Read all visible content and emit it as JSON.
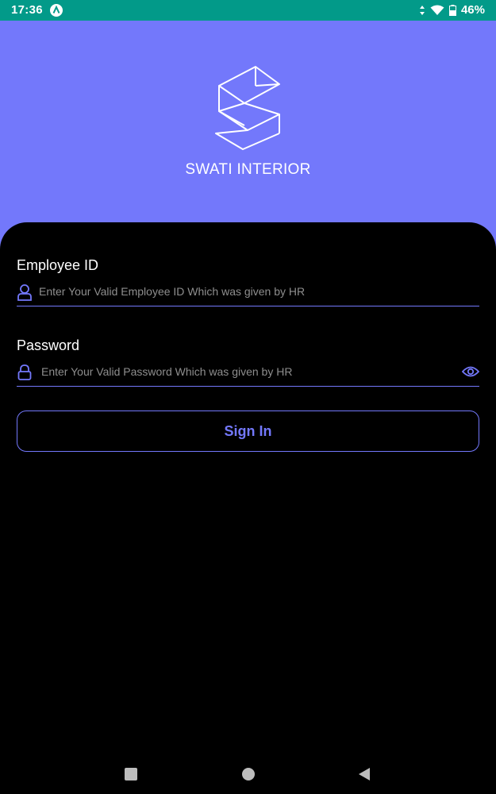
{
  "status_bar": {
    "time": "17:36",
    "battery": "46%"
  },
  "brand": {
    "name": "SWATI INTERIOR",
    "logo_icon": "swati-interior-logo"
  },
  "login": {
    "employee_id": {
      "label": "Employee ID",
      "placeholder": "Enter Your Valid Employee ID Which was given by HR",
      "value": "",
      "icon": "user-icon"
    },
    "password": {
      "label": "Password",
      "placeholder": "Enter Your Valid Password Which was given by HR",
      "value": "",
      "icon": "lock-icon",
      "toggle_icon": "eye-icon"
    },
    "sign_in_label": "Sign In"
  },
  "colors": {
    "accent": "#7378fb",
    "status_bar": "#029a89",
    "panel": "#000000"
  },
  "nav_bar": {
    "icons": [
      "recent-apps-icon",
      "home-icon",
      "back-icon"
    ]
  }
}
